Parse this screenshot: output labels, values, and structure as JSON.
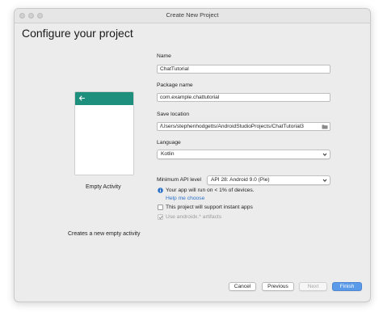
{
  "window": {
    "title": "Create New Project"
  },
  "heading": "Configure your project",
  "template": {
    "name": "Empty Activity",
    "description": "Creates a new empty activity",
    "accent_color": "#1e8f7d"
  },
  "form": {
    "name": {
      "label": "Name",
      "value": "ChatTutorial"
    },
    "package": {
      "label": "Package name",
      "value": "com.example.chattutorial"
    },
    "save_location": {
      "label": "Save location",
      "value": "/Users/stephenhodgetts/AndroidStudioProjects/ChatTutorial3"
    },
    "language": {
      "label": "Language",
      "value": "Kotlin"
    },
    "min_api": {
      "label": "Minimum API level",
      "value": "API 28: Android 9.0 (Pie)"
    },
    "api_info": "Your app will run on < 1% of devices.",
    "help_link": "Help me choose",
    "instant_apps": {
      "label": "This project will support instant apps",
      "checked": false
    },
    "androidx": {
      "label": "Use androidx.* artifacts",
      "checked": true,
      "disabled": true
    }
  },
  "buttons": {
    "cancel": "Cancel",
    "previous": "Previous",
    "next": "Next",
    "finish": "Finish"
  },
  "icons": [
    "back-arrow-icon",
    "folder-icon",
    "chevron-icon",
    "info-icon",
    "checkmark-icon"
  ]
}
